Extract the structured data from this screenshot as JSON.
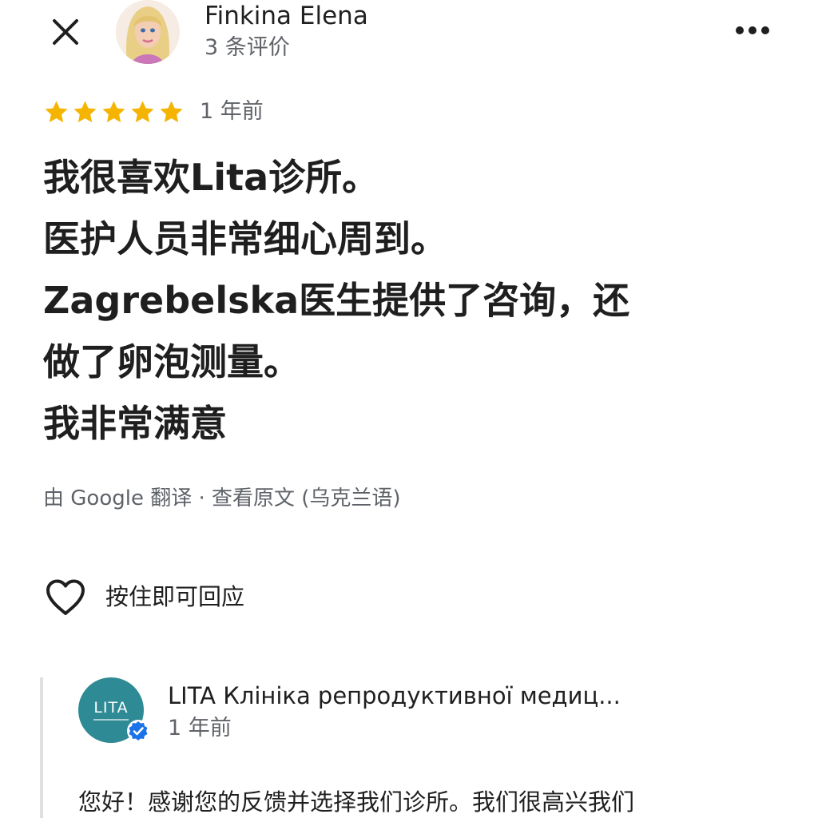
{
  "header": {
    "author_name": "Finkina Elena",
    "review_count": "3 条评价",
    "close_icon": "close-icon",
    "more_icon": "more-horizontal-icon"
  },
  "rating": {
    "stars": 5,
    "max_stars": 5,
    "star_color": "#f4b400",
    "time": "1 年前"
  },
  "review": {
    "lines": [
      "我很喜欢Lita诊所。",
      "医护人员非常细心周到。",
      "Zagrebelska医生提供了咨询，还",
      "做了卵泡测量。",
      "我非常满意"
    ]
  },
  "translation": {
    "prefix": "由 Google 翻译 · ",
    "link": "查看原文 (乌克兰语)"
  },
  "like": {
    "label": "按住即可回应",
    "icon": "heart-outline-icon"
  },
  "owner_reply": {
    "logo_text": "LITA",
    "owner_name": "LITA Клініка репродуктивної медиц...",
    "time": "1 年前",
    "text": "您好！感谢您的反馈并选择我们诊所。我们很高兴我们",
    "verified_color": "#1a73e8",
    "logo_color": "#2e8a94"
  }
}
